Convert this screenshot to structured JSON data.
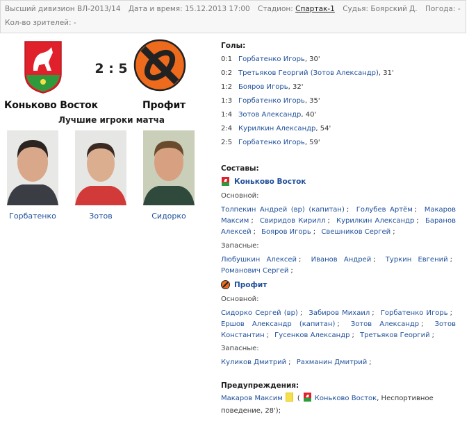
{
  "info": {
    "division": "Высший дивизион ВЛ-2013/14",
    "datetime_label": "Дата и время:",
    "datetime": "15.12.2013 17:00",
    "stadium_label": "Стадион:",
    "stadium": "Спартак-1",
    "referee_label": "Судья:",
    "referee": "Боярский Д.",
    "weather_label": "Погода:",
    "weather": "-",
    "spectators_label": "Кол-во зрителей:",
    "spectators": "-"
  },
  "match": {
    "home": "Коньково Восток",
    "away": "Профит",
    "score": "2 : 5",
    "best_title": "Лучшие игроки матча",
    "best_players": [
      "Горбатенко",
      "Зотов",
      "Сидорко"
    ]
  },
  "goals": {
    "title": "Голы:",
    "items": [
      {
        "score": "0:1",
        "text": "Горбатенко Игорь",
        "minute": ", 30'"
      },
      {
        "score": "0:2",
        "text": "Третьяков Георгий (Зотов Александр)",
        "minute": ", 31'"
      },
      {
        "score": "1:2",
        "text": "Бояров Игорь",
        "minute": ", 32'"
      },
      {
        "score": "1:3",
        "text": "Горбатенко Игорь",
        "minute": ", 35'"
      },
      {
        "score": "1:4",
        "text": "Зотов Александр",
        "minute": ", 40'"
      },
      {
        "score": "2:4",
        "text": "Курилкин Александр",
        "minute": ", 54'"
      },
      {
        "score": "2:5",
        "text": "Горбатенко Игорь",
        "minute": ", 59'"
      }
    ]
  },
  "lineups": {
    "title": "Составы:",
    "main_label": "Основной:",
    "subs_label": "Запасные:",
    "home": {
      "name": "Коньково Восток",
      "main": [
        "Толпекин Андрей (вр) (капитан)",
        "Голубев Артём",
        "Макаров Максим",
        "Свиридов Кирилл",
        "Курилкин Александр",
        "Баранов Алексей",
        "Бояров Игорь",
        "Свешников Сергей"
      ],
      "subs": [
        "Любушкин Алексей",
        "Иванов Андрей",
        "Туркин Евгений",
        "Романович Сергей"
      ]
    },
    "away": {
      "name": "Профит",
      "main": [
        "Сидорко Сергей (вр)",
        "Забиров Михаил",
        "Горбатенко Игорь",
        "Ершов Александр (капитан)",
        "Зотов Александр",
        "Зотов Константин",
        "Гусенков Александр",
        "Третьяков Георгий"
      ],
      "subs": [
        "Куликов Дмитрий",
        "Рахманин Дмитрий"
      ]
    }
  },
  "warnings": {
    "title": "Предупреждения:",
    "player": "Макаров Максим",
    "open_paren": "(",
    "team": "Коньково Восток",
    "detail": ", Неспортивное поведение, 28');"
  },
  "colors": {
    "link": "#1f4f9a",
    "home_crest_red": "#e0202a",
    "home_crest_green": "#2e9a3c",
    "away_crest_orange": "#ee6b1d",
    "yellow_card": "#f5e04a"
  }
}
